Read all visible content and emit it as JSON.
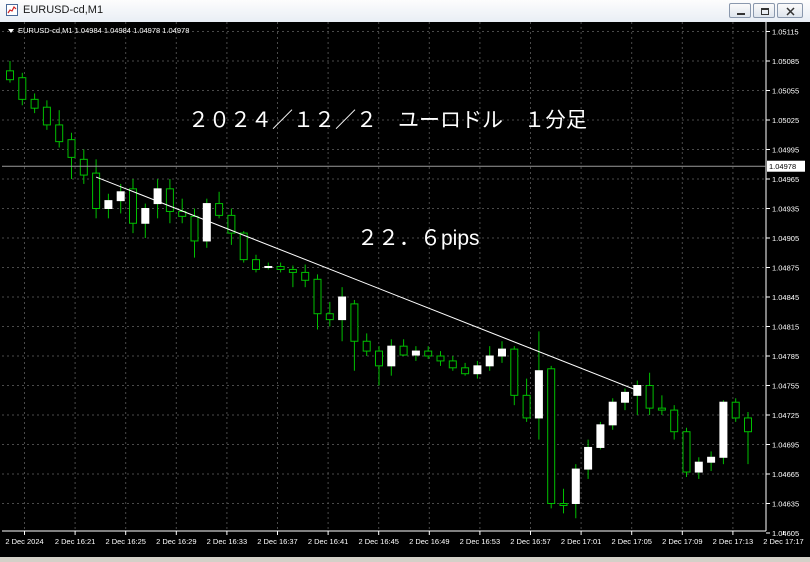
{
  "window": {
    "title": "EURUSD-cd,M1",
    "controls": [
      "minimize-icon",
      "restore-icon",
      "close-icon"
    ]
  },
  "chart": {
    "symbol_info": "EURUSD-cd,M1  1.04984 1.04984 1.04978 1.04978",
    "annotation_title": "２０２４／１２／２　ユーロドル　１分足",
    "annotation_pips": "２２．６pips",
    "current_price_label": "1.04978",
    "colors": {
      "background": "#000000",
      "grid": "#4a4a4a",
      "bull_body": "#ffffff",
      "bear_body": "#000000",
      "wick": "#00c000",
      "bear_outline": "#00c000",
      "axis_text": "#ffffff",
      "trendline": "#ffffff"
    }
  },
  "chart_data": {
    "type": "candlestick",
    "price_axis_ticks": [
      "1.05115",
      "1.05085",
      "1.05055",
      "1.05025",
      "1.04995",
      "1.04965",
      "1.04935",
      "1.04905",
      "1.04875",
      "1.04845",
      "1.04815",
      "1.04785",
      "1.04755",
      "1.04725",
      "1.04695",
      "1.04665",
      "1.04635",
      "1.04605"
    ],
    "time_axis_ticks": [
      "2 Dec 2024",
      "2 Dec 16:21",
      "2 Dec 16:25",
      "2 Dec 16:29",
      "2 Dec 16:33",
      "2 Dec 16:37",
      "2 Dec 16:41",
      "2 Dec 16:45",
      "2 Dec 16:49",
      "2 Dec 16:53",
      "2 Dec 16:57",
      "2 Dec 17:01",
      "2 Dec 17:05",
      "2 Dec 17:09",
      "2 Dec 17:13",
      "2 Dec 17:17"
    ],
    "ylim": [
      1.04595,
      1.05125
    ],
    "candles": [
      {
        "o": 1.05075,
        "h": 1.05085,
        "l": 1.05063,
        "c": 1.05066
      },
      {
        "o": 1.05068,
        "h": 1.05073,
        "l": 1.0504,
        "c": 1.05046
      },
      {
        "o": 1.05046,
        "h": 1.05052,
        "l": 1.05032,
        "c": 1.05037
      },
      {
        "o": 1.05038,
        "h": 1.05045,
        "l": 1.05015,
        "c": 1.0502
      },
      {
        "o": 1.0502,
        "h": 1.05035,
        "l": 1.04997,
        "c": 1.05003
      },
      {
        "o": 1.05005,
        "h": 1.05012,
        "l": 1.04965,
        "c": 1.04987
      },
      {
        "o": 1.04985,
        "h": 1.04995,
        "l": 1.0496,
        "c": 1.04969
      },
      {
        "o": 1.04971,
        "h": 1.04985,
        "l": 1.04925,
        "c": 1.04935
      },
      {
        "o": 1.04935,
        "h": 1.0495,
        "l": 1.04925,
        "c": 1.04943
      },
      {
        "o": 1.04943,
        "h": 1.0496,
        "l": 1.0493,
        "c": 1.04952
      },
      {
        "o": 1.04955,
        "h": 1.04965,
        "l": 1.0491,
        "c": 1.0492
      },
      {
        "o": 1.0492,
        "h": 1.0494,
        "l": 1.04905,
        "c": 1.04935
      },
      {
        "o": 1.0494,
        "h": 1.04965,
        "l": 1.04925,
        "c": 1.04955
      },
      {
        "o": 1.04955,
        "h": 1.04965,
        "l": 1.0492,
        "c": 1.04932
      },
      {
        "o": 1.04932,
        "h": 1.04945,
        "l": 1.0492,
        "c": 1.04927
      },
      {
        "o": 1.04927,
        "h": 1.04935,
        "l": 1.04885,
        "c": 1.04902
      },
      {
        "o": 1.04902,
        "h": 1.04945,
        "l": 1.04895,
        "c": 1.0494
      },
      {
        "o": 1.0494,
        "h": 1.04952,
        "l": 1.04925,
        "c": 1.04928
      },
      {
        "o": 1.04928,
        "h": 1.04935,
        "l": 1.04898,
        "c": 1.0491
      },
      {
        "o": 1.0491,
        "h": 1.04912,
        "l": 1.0488,
        "c": 1.04883
      },
      {
        "o": 1.04883,
        "h": 1.04888,
        "l": 1.0487,
        "c": 1.04873
      },
      {
        "o": 1.04875,
        "h": 1.0488,
        "l": 1.04873,
        "c": 1.04876
      },
      {
        "o": 1.04876,
        "h": 1.0488,
        "l": 1.0487,
        "c": 1.04873
      },
      {
        "o": 1.04873,
        "h": 1.04877,
        "l": 1.04855,
        "c": 1.0487
      },
      {
        "o": 1.0487,
        "h": 1.04878,
        "l": 1.04855,
        "c": 1.04862
      },
      {
        "o": 1.04863,
        "h": 1.04868,
        "l": 1.04812,
        "c": 1.04828
      },
      {
        "o": 1.04828,
        "h": 1.0484,
        "l": 1.04815,
        "c": 1.04822
      },
      {
        "o": 1.04822,
        "h": 1.04855,
        "l": 1.048,
        "c": 1.04845
      },
      {
        "o": 1.04838,
        "h": 1.04842,
        "l": 1.0477,
        "c": 1.048
      },
      {
        "o": 1.048,
        "h": 1.04808,
        "l": 1.04785,
        "c": 1.0479
      },
      {
        "o": 1.0479,
        "h": 1.04795,
        "l": 1.04755,
        "c": 1.04775
      },
      {
        "o": 1.04775,
        "h": 1.04802,
        "l": 1.04765,
        "c": 1.04795
      },
      {
        "o": 1.04795,
        "h": 1.04802,
        "l": 1.04785,
        "c": 1.04786
      },
      {
        "o": 1.04786,
        "h": 1.04795,
        "l": 1.0478,
        "c": 1.0479
      },
      {
        "o": 1.0479,
        "h": 1.04795,
        "l": 1.04782,
        "c": 1.04785
      },
      {
        "o": 1.04785,
        "h": 1.0479,
        "l": 1.04775,
        "c": 1.0478
      },
      {
        "o": 1.0478,
        "h": 1.04785,
        "l": 1.0477,
        "c": 1.04773
      },
      {
        "o": 1.04773,
        "h": 1.04778,
        "l": 1.04765,
        "c": 1.04767
      },
      {
        "o": 1.04767,
        "h": 1.0478,
        "l": 1.04762,
        "c": 1.04775
      },
      {
        "o": 1.04775,
        "h": 1.04795,
        "l": 1.0477,
        "c": 1.04785
      },
      {
        "o": 1.04785,
        "h": 1.048,
        "l": 1.04778,
        "c": 1.04792
      },
      {
        "o": 1.04792,
        "h": 1.04795,
        "l": 1.04735,
        "c": 1.04745
      },
      {
        "o": 1.04745,
        "h": 1.04762,
        "l": 1.04718,
        "c": 1.04722
      },
      {
        "o": 1.04722,
        "h": 1.0481,
        "l": 1.047,
        "c": 1.0477
      },
      {
        "o": 1.04772,
        "h": 1.04775,
        "l": 1.0463,
        "c": 1.04635
      },
      {
        "o": 1.04635,
        "h": 1.0465,
        "l": 1.04625,
        "c": 1.04633
      },
      {
        "o": 1.04635,
        "h": 1.04675,
        "l": 1.0462,
        "c": 1.0467
      },
      {
        "o": 1.0467,
        "h": 1.047,
        "l": 1.0466,
        "c": 1.04692
      },
      {
        "o": 1.04692,
        "h": 1.04718,
        "l": 1.0469,
        "c": 1.04715
      },
      {
        "o": 1.04715,
        "h": 1.04742,
        "l": 1.0471,
        "c": 1.04738
      },
      {
        "o": 1.04738,
        "h": 1.04752,
        "l": 1.0473,
        "c": 1.04748
      },
      {
        "o": 1.04745,
        "h": 1.0476,
        "l": 1.04725,
        "c": 1.04755
      },
      {
        "o": 1.04755,
        "h": 1.04768,
        "l": 1.04725,
        "c": 1.04732
      },
      {
        "o": 1.04732,
        "h": 1.04745,
        "l": 1.04725,
        "c": 1.0473
      },
      {
        "o": 1.0473,
        "h": 1.04735,
        "l": 1.047,
        "c": 1.04708
      },
      {
        "o": 1.04708,
        "h": 1.04712,
        "l": 1.04662,
        "c": 1.04667
      },
      {
        "o": 1.04667,
        "h": 1.04682,
        "l": 1.0466,
        "c": 1.04677
      },
      {
        "o": 1.04677,
        "h": 1.04688,
        "l": 1.04668,
        "c": 1.04682
      },
      {
        "o": 1.04682,
        "h": 1.0474,
        "l": 1.04675,
        "c": 1.04738
      },
      {
        "o": 1.04738,
        "h": 1.04742,
        "l": 1.04718,
        "c": 1.04722
      },
      {
        "o": 1.04722,
        "h": 1.04728,
        "l": 1.04675,
        "c": 1.04708
      }
    ],
    "current_price": 1.04978,
    "trendline": {
      "from_candle": 7,
      "from_price": 1.04967,
      "to_candle": 51,
      "to_price": 1.0475
    },
    "grid": true
  }
}
